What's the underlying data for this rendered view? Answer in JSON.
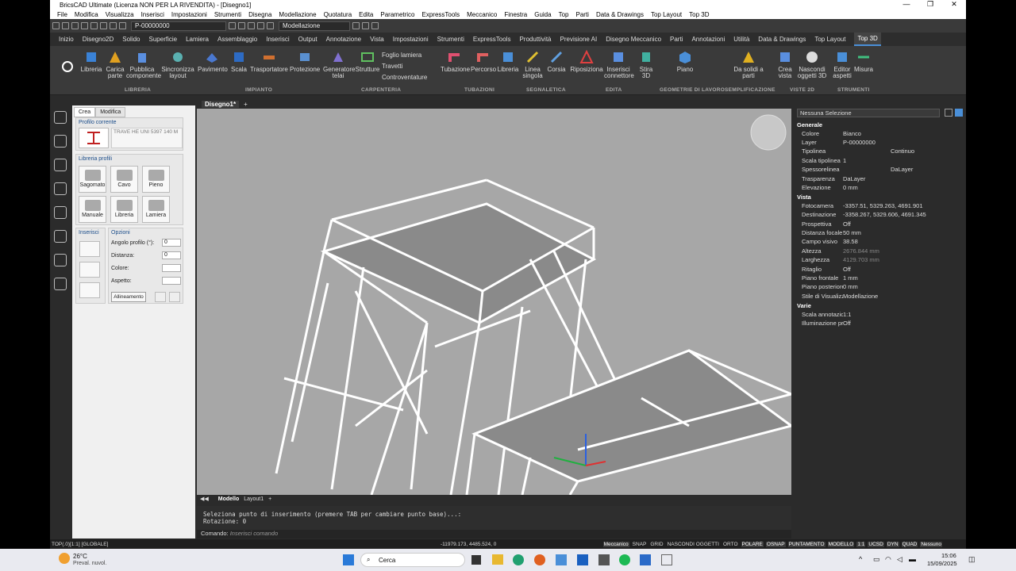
{
  "app": {
    "title": "BricsCAD Ultimate (Licenza NON PER LA RIVENDITA) - [Disegno1]"
  },
  "menu": [
    "File",
    "Modifica",
    "Visualizza",
    "Inserisci",
    "Impostazioni",
    "Strumenti",
    "Disegna",
    "Modellazione",
    "Quotatura",
    "Edita",
    "Parametrico",
    "ExpressTools",
    "Meccanico",
    "Finestra",
    "Guida",
    "Top",
    "Parti",
    "Data & Drawings",
    "Top Layout",
    "Top 3D"
  ],
  "toolbar": {
    "layer": "P-00000000",
    "workspace": "Modellazione"
  },
  "ribbon_tabs": [
    "Inizio",
    "Disegno2D",
    "Solido",
    "Superficie",
    "Lamiera",
    "Assemblaggio",
    "Inserisci",
    "Output",
    "Annotazione",
    "Vista",
    "Impostazioni",
    "Strumenti",
    "ExpressTools",
    "Produttività",
    "Previsione AI",
    "Disegno Meccanico",
    "Parti",
    "Annotazioni",
    "Utilità",
    "Data & Drawings",
    "Top Layout",
    "Top 3D"
  ],
  "ribbon": {
    "buttons": [
      "Libreria",
      "Carica parte",
      "Pubblica componente",
      "Sincronizza layout",
      "Pavimento",
      "Scala",
      "Trasportatore",
      "Protezione",
      "Generatore telai",
      "Strutture",
      "Tubazione",
      "Percorso",
      "Libreria",
      "Linea singola",
      "Corsia",
      "Riposiziona",
      "Inserisci connettore",
      "Stira 3D",
      "Piano",
      "Da solidi a parti",
      "Crea vista",
      "Nascondi oggetti 3D",
      "Editor aspetti",
      "Misura"
    ],
    "small": [
      "Foglio lamiera",
      "Travetti",
      "Controventature"
    ],
    "groups": [
      "LIBRERIA",
      "IMPIANTO",
      "CARPENTERIA",
      "TUBAZIONI",
      "SEGNALETICA",
      "EDITA",
      "GEOMETRIE DI LAVORO",
      "SEMPLIFICAZIONE",
      "VISTE 2D",
      "STRUMENTI"
    ]
  },
  "panel": {
    "tabs": [
      "Crea",
      "Modifica"
    ],
    "profilo_corrente": "Profilo corrente",
    "profile_name": "TRAVE HE UNI 5397 140 M",
    "libreria_profili": "Libreria profili",
    "lib_buttons": [
      "Sagomato",
      "Cavo",
      "Pieno",
      "Manuale",
      "Libreria",
      "Lamiera"
    ],
    "inserisci": "Inserisci",
    "opzioni": "Opzioni",
    "angolo_label": "Angolo profilo (°):",
    "angolo": "0",
    "distanza_label": "Distanza:",
    "distanza": "0",
    "colore_label": "Colore:",
    "aspetto_label": "Aspetto:",
    "allineamento": "Allineamento"
  },
  "document": {
    "tab": "Disegno1*",
    "layouts": [
      "Modello",
      "Layout1"
    ]
  },
  "command": {
    "line1": "Seleziona punto di inserimento (premere TAB per cambiare punto base)...:",
    "line2": "Rotazione: 0",
    "prompt": "Comando:",
    "placeholder": "Inserisci comando"
  },
  "props": {
    "selection": "Nessuna Selezione",
    "groups": {
      "generale": "Generale",
      "vista": "Vista",
      "varie": "Varie"
    },
    "generale": [
      [
        "Colore",
        "Bianco"
      ],
      [
        "Layer",
        "P-00000000"
      ],
      [
        "Tipolinea",
        "Continuo"
      ],
      [
        "Scala tipolinea",
        "1"
      ],
      [
        "Spessorelinea",
        "DaLayer"
      ],
      [
        "Trasparenza",
        "DaLayer"
      ],
      [
        "Elevazione",
        "0 mm"
      ]
    ],
    "vista": [
      [
        "Fotocamera",
        "-3357.51, 5329.263, 4691.901"
      ],
      [
        "Destinazione",
        "-3358.267, 5329.606, 4691.345"
      ],
      [
        "Prospettiva",
        "Off"
      ],
      [
        "Distanza focale",
        "50 mm"
      ],
      [
        "Campo visivo",
        "38.58"
      ],
      [
        "Altezza",
        "2676.844 mm"
      ],
      [
        "Larghezza",
        "4129.703 mm"
      ],
      [
        "Ritaglio",
        "Off"
      ],
      [
        "Piano frontale",
        "1 mm"
      ],
      [
        "Piano posteriore",
        "0 mm"
      ],
      [
        "Stile di Visualizzazione",
        "Modellazione"
      ]
    ],
    "varie": [
      [
        "Scala annotazione",
        "1:1"
      ],
      [
        "Illuminazione predefinita",
        "Off"
      ]
    ]
  },
  "status": {
    "left": "TOP(.0)[1:1] [GLOBALE]",
    "coords": "-11979.173, 4485.524, 0",
    "items": [
      "Meccanico",
      "SNAP",
      "GRID",
      "NASCONDI OGGETTI",
      "ORTO",
      "POLARE",
      "OSNAP",
      "PUNTAMENTO",
      "MODELLO",
      "1:1",
      "UCSD",
      "DYN",
      "QUAD",
      "Nessuno"
    ]
  },
  "taskbar": {
    "temp": "26°C",
    "weather": "Preval. nuvol.",
    "search": "Cerca",
    "time": "15:06",
    "date": "15/09/2025"
  }
}
